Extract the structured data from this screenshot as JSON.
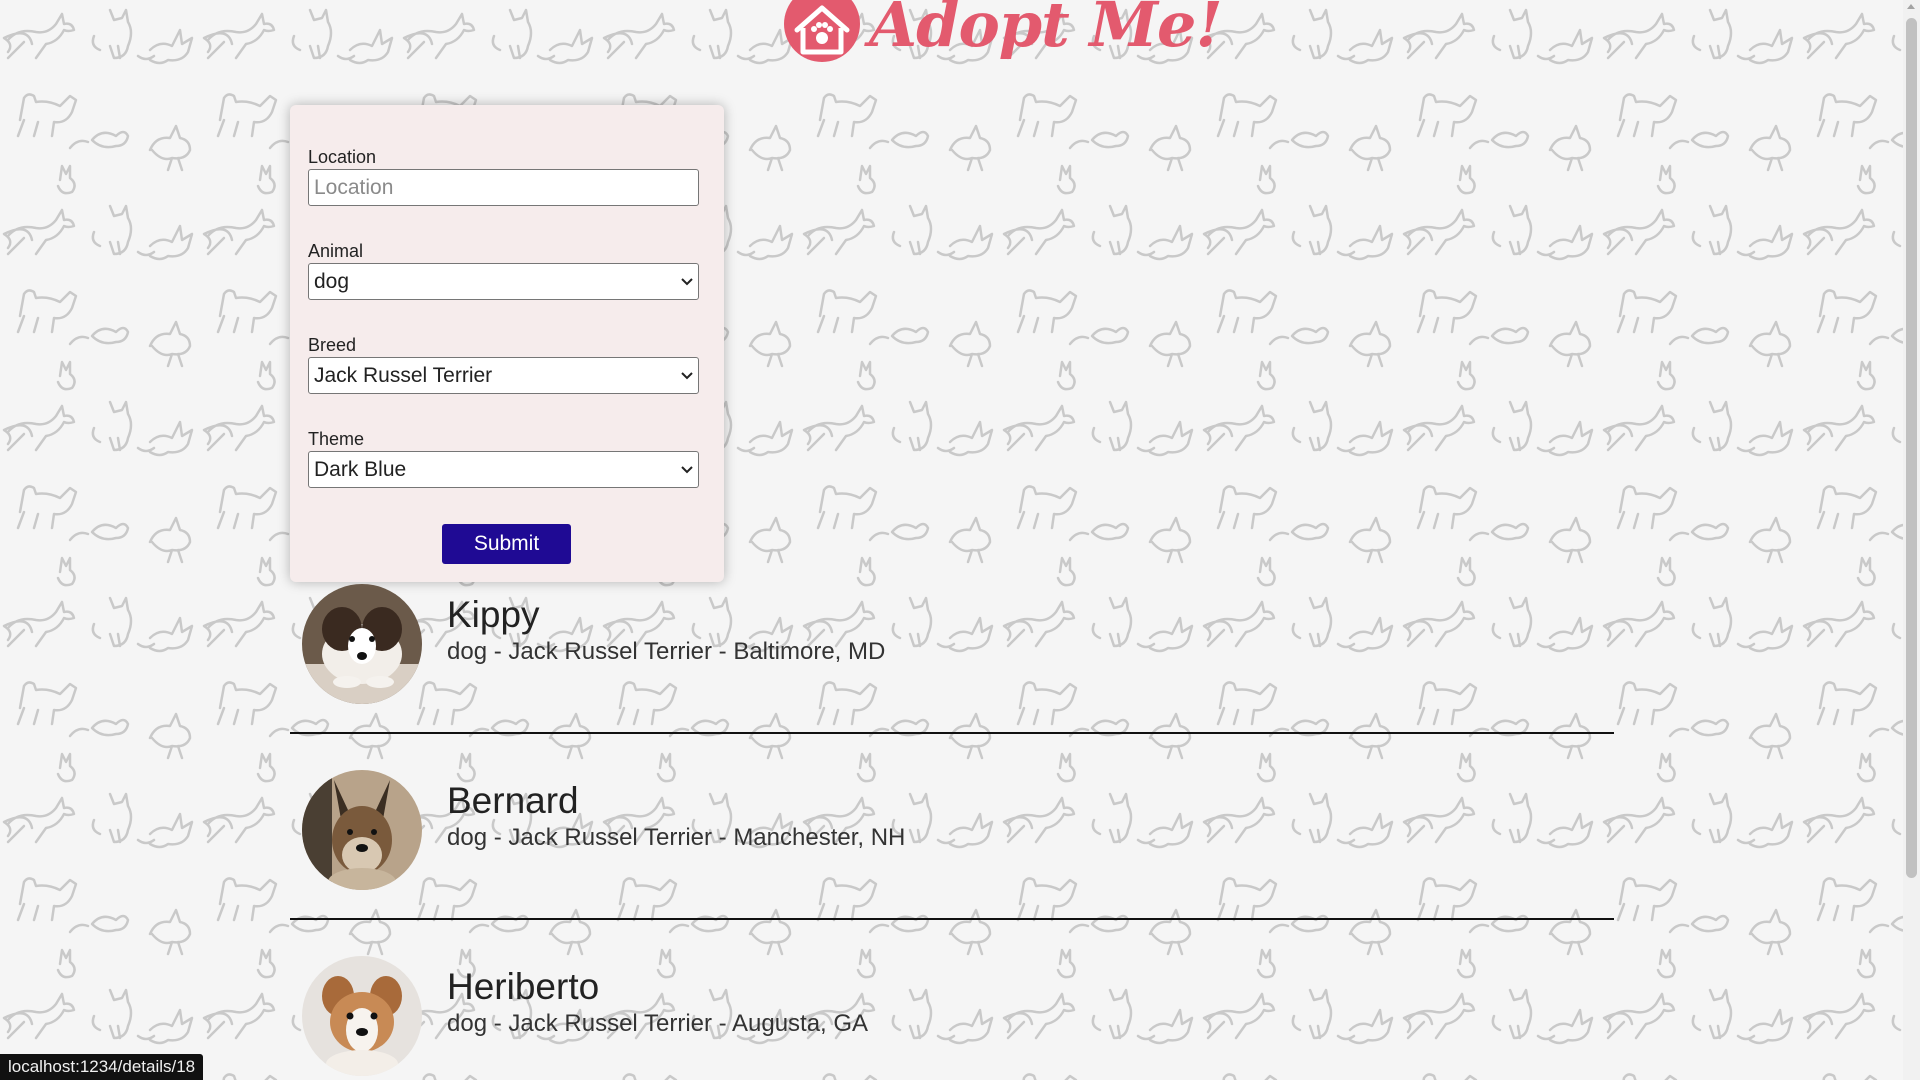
{
  "header": {
    "title": "Adopt Me!",
    "logo_icon": "house-paw-icon"
  },
  "search_form": {
    "location": {
      "label": "Location",
      "value": "",
      "placeholder": "Location"
    },
    "animal": {
      "label": "Animal",
      "selected": "dog"
    },
    "breed": {
      "label": "Breed",
      "selected": "Jack Russel Terrier"
    },
    "theme": {
      "label": "Theme",
      "selected": "Dark Blue"
    },
    "submit_label": "Submit"
  },
  "pets": [
    {
      "name": "Kippy",
      "info": "dog - Jack Russel Terrier - Baltimore, MD"
    },
    {
      "name": "Bernard",
      "info": "dog - Jack Russel Terrier - Manchester, NH"
    },
    {
      "name": "Heriberto",
      "info": "dog - Jack Russel Terrier - Augusta, GA"
    }
  ],
  "status_bar": {
    "url": "localhost:1234/details/18"
  },
  "colors": {
    "brand": "#e35a6e",
    "submit_button": "#1f0a94",
    "card_background": "#f6ecec",
    "page_background": "#f5f5f5"
  }
}
